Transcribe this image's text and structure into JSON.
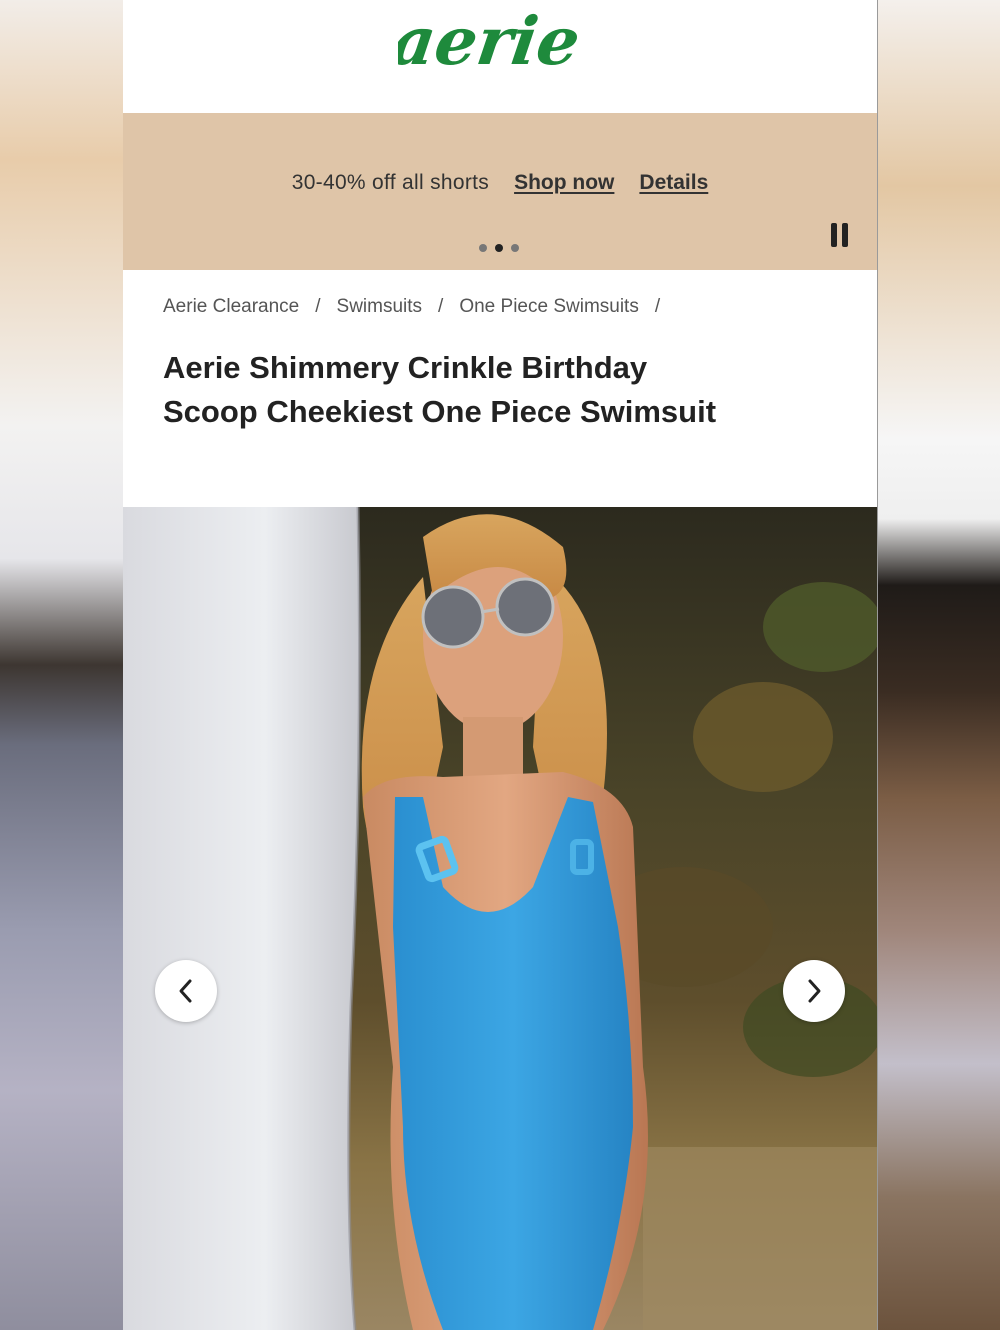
{
  "brand": {
    "logo_text": "aerie",
    "logo_color": "#1e8a3c"
  },
  "promo": {
    "text": "30-40% off all shorts",
    "shop_link": "Shop now",
    "details_link": "Details",
    "background": "#dfc5a8",
    "slide_count": 3,
    "active_slide": 2,
    "pause_icon": "pause-icon"
  },
  "breadcrumb": {
    "items": [
      "Aerie Clearance",
      "Swimsuits",
      "One Piece Swimsuits"
    ],
    "separator": "/"
  },
  "product": {
    "title": "Aerie Shimmery Crinkle Birthday Scoop Cheekiest One Piece Swimsuit"
  },
  "gallery": {
    "prev_icon": "chevron-left-icon",
    "next_icon": "chevron-right-icon"
  }
}
